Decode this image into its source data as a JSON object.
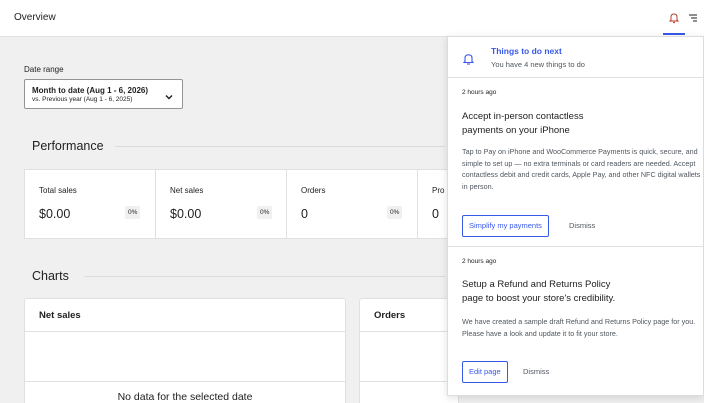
{
  "header": {
    "title": "Overview"
  },
  "date_range": {
    "label": "Date range",
    "selected_line1": "Month to date (Aug 1 - 6, 2026)",
    "selected_line2": "vs. Previous year (Aug 1 - 6, 2025)"
  },
  "performance": {
    "heading": "Performance",
    "items": [
      {
        "label": "Total sales",
        "value": "$0.00",
        "delta": "0%"
      },
      {
        "label": "Net sales",
        "value": "$0.00",
        "delta": "0%"
      },
      {
        "label": "Orders",
        "value": "0",
        "delta": "0%"
      },
      {
        "label": "Pro",
        "value": "0"
      }
    ]
  },
  "charts": {
    "heading": "Charts",
    "cards": [
      {
        "title": "Net sales",
        "empty_text": "No data for the selected date"
      },
      {
        "title": "Orders"
      }
    ]
  },
  "inbox_panel": {
    "title": "Things to do next",
    "subtitle": "You have 4 new things to do",
    "notes": [
      {
        "time": "2 hours ago",
        "title_line1": "Accept in-person contactless",
        "title_line2": "payments on your iPhone",
        "body": "Tap to Pay on iPhone and WooCommerce Payments is quick, secure, and simple to set up — no extra terminals or card readers are needed. Accept contactless debit and credit cards, Apple Pay, and other NFC digital wallets in person.",
        "primary_action": "Simplify my payments",
        "dismiss": "Dismiss"
      },
      {
        "time": "2 hours ago",
        "title_line1": "Setup a Refund and Returns Policy",
        "title_line2": "page to boost your store's credibility.",
        "body": "We have created a sample draft Refund and Returns Policy page for you. Please have a look and update it to fit your store.",
        "primary_action": "Edit page",
        "dismiss": "Dismiss"
      }
    ]
  },
  "colors": {
    "accent": "#3858e9",
    "background": "#f0f0f0",
    "border": "#e0e0e0"
  },
  "icons": [
    "bell-icon",
    "menu-icon",
    "chevron-down-icon"
  ]
}
